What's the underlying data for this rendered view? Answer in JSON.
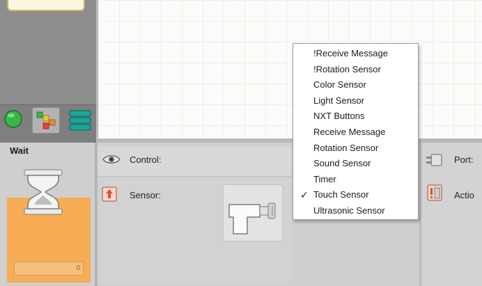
{
  "block": {
    "title": "Wait",
    "counter": "0"
  },
  "palette": {
    "tabs": [
      {
        "name": "common-palette",
        "icon": "green-circle-icon"
      },
      {
        "name": "complete-palette",
        "icon": "colored-blocks-icon"
      },
      {
        "name": "custom-palette",
        "icon": "stacked-bars-icon"
      }
    ]
  },
  "config": {
    "control_label": "Control:",
    "sensor_label": "Sensor:",
    "port_label": "Port:",
    "action_label": "Actio"
  },
  "dropdown": {
    "items": [
      {
        "label": "!Receive Message",
        "checked": false
      },
      {
        "label": "!Rotation Sensor",
        "checked": false
      },
      {
        "label": "Color Sensor",
        "checked": false
      },
      {
        "label": "Light Sensor",
        "checked": false
      },
      {
        "label": "NXT Buttons",
        "checked": false
      },
      {
        "label": "Receive Message",
        "checked": false
      },
      {
        "label": "Rotation Sensor",
        "checked": false
      },
      {
        "label": "Sound Sensor",
        "checked": false
      },
      {
        "label": "Timer",
        "checked": false
      },
      {
        "label": "Touch Sensor",
        "checked": true,
        "mark": "✓"
      },
      {
        "label": "Ultrasonic Sensor",
        "checked": false
      }
    ]
  },
  "colors": {
    "accent_orange": "#f7ac55",
    "palette_green": "#3bb54a",
    "palette_teal": "#17a89a"
  }
}
